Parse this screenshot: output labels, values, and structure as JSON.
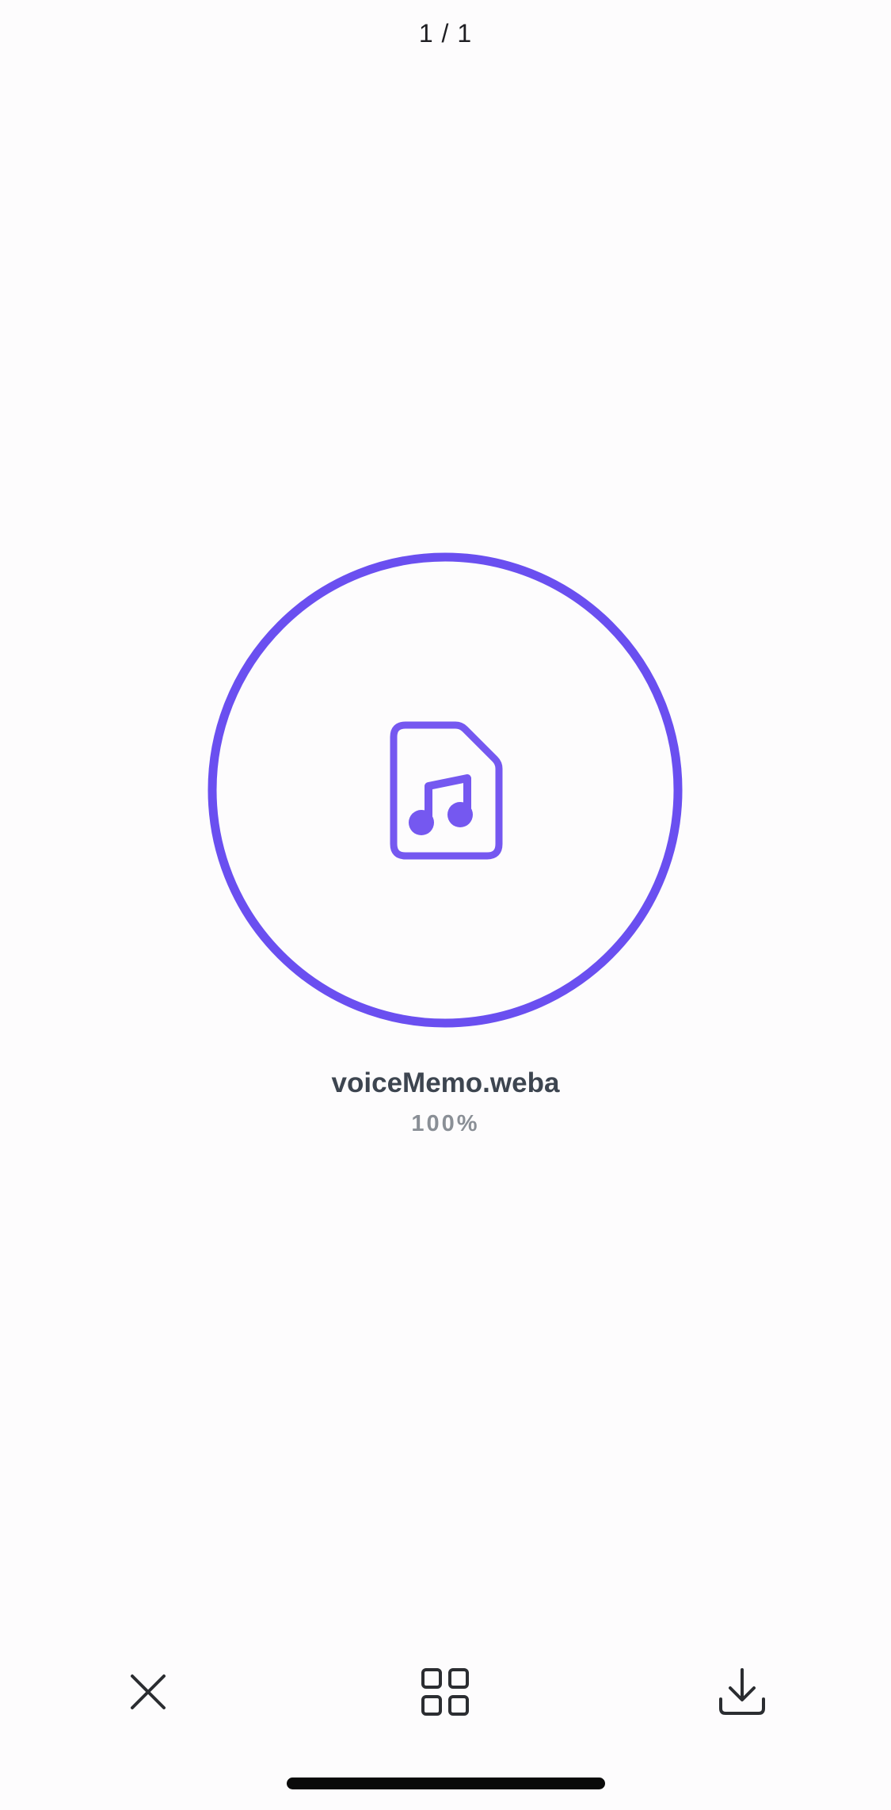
{
  "viewer": {
    "counter": "1 / 1",
    "file_name": "voiceMemo.weba",
    "progress_text": "100%",
    "progress_fraction": 1.0,
    "accent_color": "#6a4ff0",
    "file_icon": "audio-file-icon"
  },
  "toolbar": {
    "close_icon": "close-icon",
    "grid_icon": "grid-icon",
    "download_icon": "download-icon"
  }
}
